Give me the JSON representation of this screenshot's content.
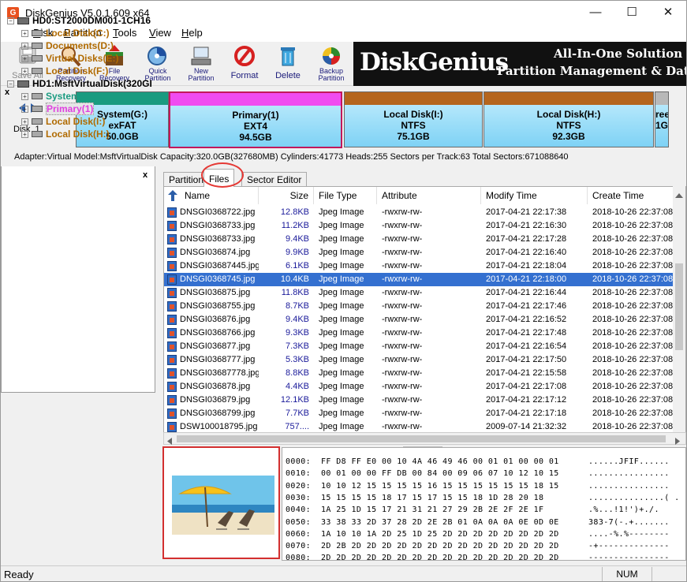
{
  "window": {
    "title": "DiskGenius V5.0.1.609 x64",
    "app_icon": "G",
    "minimize": "—",
    "maximize": "☐",
    "close": "✕"
  },
  "menu": [
    {
      "u": "D",
      "rest": "isk"
    },
    {
      "u": "P",
      "rest": "artition"
    },
    {
      "u": "T",
      "rest": "ools"
    },
    {
      "u": "V",
      "rest": "iew"
    },
    {
      "u": "H",
      "rest": "elp"
    }
  ],
  "toolbar": {
    "save_all": "Save All",
    "partition_recovery": [
      "Partition",
      "Recovery"
    ],
    "file_recovery": [
      "File",
      "Recovery"
    ],
    "quick_partition": [
      "Quick",
      "Partition"
    ],
    "new_partition": [
      "New",
      "Partition"
    ],
    "format": "Format",
    "delete": "Delete",
    "backup_partition": [
      "Backup",
      "Partition"
    ]
  },
  "banner": {
    "logo": "DiskGenius",
    "tag1": "All-In-One Solution For",
    "tag2": "Partition Management & Data R"
  },
  "disk_nav": {
    "label": "Disk  1"
  },
  "partitions": [
    {
      "name": "System(G:)",
      "fs": "exFAT",
      "size": "50.0GB",
      "color": "#1a9b80"
    },
    {
      "name": "Primary(1)",
      "fs": "EXT4",
      "size": "94.5GB",
      "color": "#f04bf0"
    },
    {
      "name": "Local Disk(I:)",
      "fs": "NTFS",
      "size": "75.1GB",
      "color": "#b5651d"
    },
    {
      "name": "Local Disk(H:)",
      "fs": "NTFS",
      "size": "92.3GB",
      "color": "#b5651d"
    },
    {
      "name": "ree",
      "fs": "",
      "size": "1G",
      "color": "#b8b8b8"
    }
  ],
  "adapter_info": "Adapter:Virtual  Model:MsftVirtualDisk  Capacity:320.0GB(327680MB)  Cylinders:41773  Heads:255  Sectors per Track:63  Total Sectors:671088640",
  "tree": {
    "disks": [
      {
        "label": "HD0:ST2000DM001-1CH16",
        "children": [
          {
            "label": "Local Disk(C:)",
            "color": "#b06a00"
          },
          {
            "label": "Documents(D:)",
            "color": "#b06a00"
          },
          {
            "label": "Virtual Disks(E:)",
            "color": "#b06a00"
          },
          {
            "label": "Local Disk(F:)",
            "color": "#b06a00"
          }
        ]
      },
      {
        "label": "HD1:MsftVirtualDisk(320GI",
        "children": [
          {
            "label": "System(G:)",
            "color": "#1a9b80"
          },
          {
            "label": "Primary(1)",
            "color": "#e040e0"
          },
          {
            "label": "Local Disk(I:)",
            "color": "#b06a00"
          },
          {
            "label": "Local Disk(H:)",
            "color": "#b06a00"
          }
        ]
      }
    ]
  },
  "tabs": [
    "Partitions",
    "Files",
    "Sector Editor"
  ],
  "file_table": {
    "columns": [
      "Name",
      "Size",
      "File Type",
      "Attribute",
      "Modify Time",
      "Create Time"
    ],
    "rows": [
      [
        "DNSGI0368722.jpg",
        "12.8KB",
        "Jpeg Image",
        "-rwxrw-rw-",
        "2017-04-21 22:17:38",
        "2018-10-26 22:37:08"
      ],
      [
        "DNSGI0368733.jpg",
        "11.2KB",
        "Jpeg Image",
        "-rwxrw-rw-",
        "2017-04-21 22:16:30",
        "2018-10-26 22:37:08"
      ],
      [
        "DNSGI0368733.jpg",
        "9.4KB",
        "Jpeg Image",
        "-rwxrw-rw-",
        "2017-04-21 22:17:28",
        "2018-10-26 22:37:08"
      ],
      [
        "DNSGI036874.jpg",
        "9.9KB",
        "Jpeg Image",
        "-rwxrw-rw-",
        "2017-04-21 22:16:40",
        "2018-10-26 22:37:08"
      ],
      [
        "DNSGI03687445.jpg",
        "6.1KB",
        "Jpeg Image",
        "-rwxrw-rw-",
        "2017-04-21 22:18:04",
        "2018-10-26 22:37:08"
      ],
      [
        "DNSGI0368745.jpg",
        "10.4KB",
        "Jpeg Image",
        "-rwxrw-rw-",
        "2017-04-21 22:18:00",
        "2018-10-26 22:37:08"
      ],
      [
        "DNSGI036875.jpg",
        "11.8KB",
        "Jpeg Image",
        "-rwxrw-rw-",
        "2017-04-21 22:16:44",
        "2018-10-26 22:37:08"
      ],
      [
        "DNSGI0368755.jpg",
        "8.7KB",
        "Jpeg Image",
        "-rwxrw-rw-",
        "2017-04-21 22:17:46",
        "2018-10-26 22:37:08"
      ],
      [
        "DNSGI036876.jpg",
        "9.4KB",
        "Jpeg Image",
        "-rwxrw-rw-",
        "2017-04-21 22:16:52",
        "2018-10-26 22:37:08"
      ],
      [
        "DNSGI0368766.jpg",
        "9.3KB",
        "Jpeg Image",
        "-rwxrw-rw-",
        "2017-04-21 22:17:48",
        "2018-10-26 22:37:08"
      ],
      [
        "DNSGI036877.jpg",
        "7.3KB",
        "Jpeg Image",
        "-rwxrw-rw-",
        "2017-04-21 22:16:54",
        "2018-10-26 22:37:08"
      ],
      [
        "DNSGI0368777.jpg",
        "5.3KB",
        "Jpeg Image",
        "-rwxrw-rw-",
        "2017-04-21 22:17:50",
        "2018-10-26 22:37:08"
      ],
      [
        "DNSGI03687778.jpg",
        "8.8KB",
        "Jpeg Image",
        "-rwxrw-rw-",
        "2017-04-21 22:15:58",
        "2018-10-26 22:37:08"
      ],
      [
        "DNSGI036878.jpg",
        "4.4KB",
        "Jpeg Image",
        "-rwxrw-rw-",
        "2017-04-21 22:17:08",
        "2018-10-26 22:37:08"
      ],
      [
        "DNSGI036879.jpg",
        "12.1KB",
        "Jpeg Image",
        "-rwxrw-rw-",
        "2017-04-21 22:17:12",
        "2018-10-26 22:37:08"
      ],
      [
        "DNSGI0368799.jpg",
        "7.7KB",
        "Jpeg Image",
        "-rwxrw-rw-",
        "2017-04-21 22:17:18",
        "2018-10-26 22:37:08"
      ],
      [
        "DSW100018795.jpg",
        "757....",
        "Jpeg Image",
        "-rwxrw-rw-",
        "2009-07-14 21:32:32",
        "2018-10-26 22:37:08"
      ]
    ],
    "selected_row": 5
  },
  "hex_dump": [
    {
      "off": "0000:",
      "hex": "FF D8 FF E0 00 10 4A 46 49 46 00 01 01 00 00 01",
      "ascii": "......JFIF......"
    },
    {
      "off": "0010:",
      "hex": "00 01 00 00 FF DB 00 84 00 09 06 07 10 12 10 15",
      "ascii": "................"
    },
    {
      "off": "0020:",
      "hex": "10 10 12 15 15 15 15 16 15 15 15 15 15 15 18 15",
      "ascii": "................"
    },
    {
      "off": "0030:",
      "hex": "15 15 15 15 18 17 15 17 15 15 18 1D 28 20 18",
      "ascii": "...............( ."
    },
    {
      "off": "0040:",
      "hex": "1A 25 1D 15 17 21 31 21 27 29 2B 2E 2F 2E 1F",
      "ascii": ".%...!1!')+./."
    },
    {
      "off": "0050:",
      "hex": "33 38 33 2D 37 28 2D 2E 2B 01 0A 0A 0A 0E 0D 0E",
      "ascii": "383-7(-.+......."
    },
    {
      "off": "0060:",
      "hex": "1A 10 10 1A 2D 25 1D 25 2D 2D 2D 2D 2D 2D 2D 2D",
      "ascii": "....-%.%--------"
    },
    {
      "off": "0070:",
      "hex": "2D 2B 2D 2D 2D 2D 2D 2D 2D 2D 2D 2D 2D 2D 2D 2D",
      "ascii": "-+--------------"
    },
    {
      "off": "0080:",
      "hex": "2D 2D 2D 2D 2D 2D 2D 2D 2D 2D 2D 2D 2D 2D 2D 2D",
      "ascii": "----------------"
    }
  ],
  "status": {
    "left": "Ready",
    "num": "NUM"
  }
}
